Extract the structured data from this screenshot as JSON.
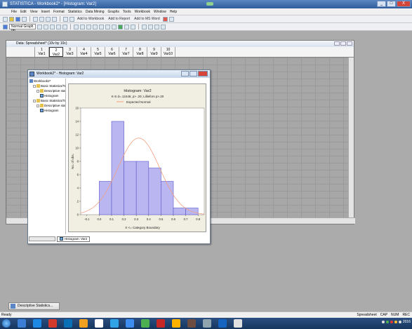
{
  "app": {
    "title": "STATISTICA - Workbook2* - [Histogram: Var2]",
    "window_buttons": [
      "_",
      "□",
      "X"
    ]
  },
  "menu": [
    "File",
    "Edit",
    "View",
    "Insert",
    "Format",
    "Statistics",
    "Data Mining",
    "Graphs",
    "Tools",
    "Workbook",
    "Window",
    "Help"
  ],
  "toolbar": {
    "add_workbook": "Add to Workbook",
    "add_report": "Add to Report",
    "add_ms": "Add to MS Word",
    "graph_combo": "Normal Graph (m..."
  },
  "spreadsheet": {
    "title": "Data: Spreadsheet* (10v by 10c)",
    "columns": [
      {
        "num": "1",
        "name": "Var1"
      },
      {
        "num": "2",
        "name": "Var2"
      },
      {
        "num": "3",
        "name": "Var3"
      },
      {
        "num": "4",
        "name": "Var4"
      },
      {
        "num": "5",
        "name": "Var5"
      },
      {
        "num": "6",
        "name": "Var6"
      },
      {
        "num": "7",
        "name": "Var7"
      },
      {
        "num": "8",
        "name": "Var8"
      },
      {
        "num": "9",
        "name": "Var9"
      },
      {
        "num": "10",
        "name": "Var10"
      }
    ]
  },
  "workbook": {
    "title": "Workbook2* - Histogram: Var2",
    "tree": [
      {
        "label": "Workbook2*",
        "level": 0,
        "icon": "book-icon"
      },
      {
        "label": "Basic Statistics/Tab",
        "level": 1,
        "icon": "folder-icon"
      },
      {
        "label": "Descriptive stat",
        "level": 2,
        "icon": "folder-icon"
      },
      {
        "label": "Histogram",
        "level": 3,
        "icon": "chart-icon"
      },
      {
        "label": "Basic Statistics/Tab",
        "level": 1,
        "icon": "folder-icon"
      },
      {
        "label": "Descriptive stat",
        "level": 2,
        "icon": "folder-icon"
      },
      {
        "label": "Histogram",
        "level": 3,
        "icon": "chart-icon"
      }
    ],
    "tab_label": "Histogram: Var2"
  },
  "chart_data": {
    "type": "bar",
    "title": "Histogram: Var2",
    "subtitle": "K-S d=.12448, p> .20; Lilliefors p>.20",
    "legend": "Expected Normal",
    "xlabel": "X <= Category Boundary",
    "ylabel": "No. of obs.",
    "categories": [
      "-0.1",
      "0.0",
      "0.1",
      "0.2",
      "0.3",
      "0.4",
      "0.5",
      "0.6",
      "0.7",
      "0.8"
    ],
    "bins": [
      {
        "from": 0.0,
        "to": 0.1,
        "count": 5
      },
      {
        "from": 0.1,
        "to": 0.2,
        "count": 14
      },
      {
        "from": 0.2,
        "to": 0.3,
        "count": 8
      },
      {
        "from": 0.3,
        "to": 0.4,
        "count": 8
      },
      {
        "from": 0.4,
        "to": 0.5,
        "count": 7
      },
      {
        "from": 0.5,
        "to": 0.6,
        "count": 5
      },
      {
        "from": 0.6,
        "to": 0.7,
        "count": 1
      },
      {
        "from": 0.7,
        "to": 0.8,
        "count": 1
      }
    ],
    "xlim": [
      -0.15,
      0.85
    ],
    "ylim": [
      0,
      16
    ],
    "yticks": [
      "0",
      "2",
      "4",
      "6",
      "8",
      "10",
      "12",
      "14",
      "16"
    ],
    "normal_curve": {
      "mean": 0.32,
      "sd": 0.17,
      "n": 49,
      "bin_width": 0.1
    },
    "colors": {
      "bar": "#b9b6f2",
      "bar_stroke": "#5c58c8",
      "curve": "#f2a07e",
      "plot_bg": "#ffffff",
      "panel_bg": "#f1efe2"
    }
  },
  "minimized": {
    "label": "Descriptive Statistics..."
  },
  "status": {
    "left": "Ready",
    "right": [
      "Spreadsheet",
      "CAP",
      "NUM",
      "REC"
    ]
  },
  "taskbar": {
    "apps": [
      "#3a7fd5",
      "#1e88e5",
      "#d23b2b",
      "#0b6fb5",
      "#f0a020",
      "#ffffff",
      "#2fa3e6",
      "#3d8cf0",
      "#4caf50",
      "#c62828",
      "#ffb300",
      "#6d4c41",
      "#90a4ae",
      "#1565c0",
      "#e0e0e0"
    ],
    "clock": "2016"
  }
}
